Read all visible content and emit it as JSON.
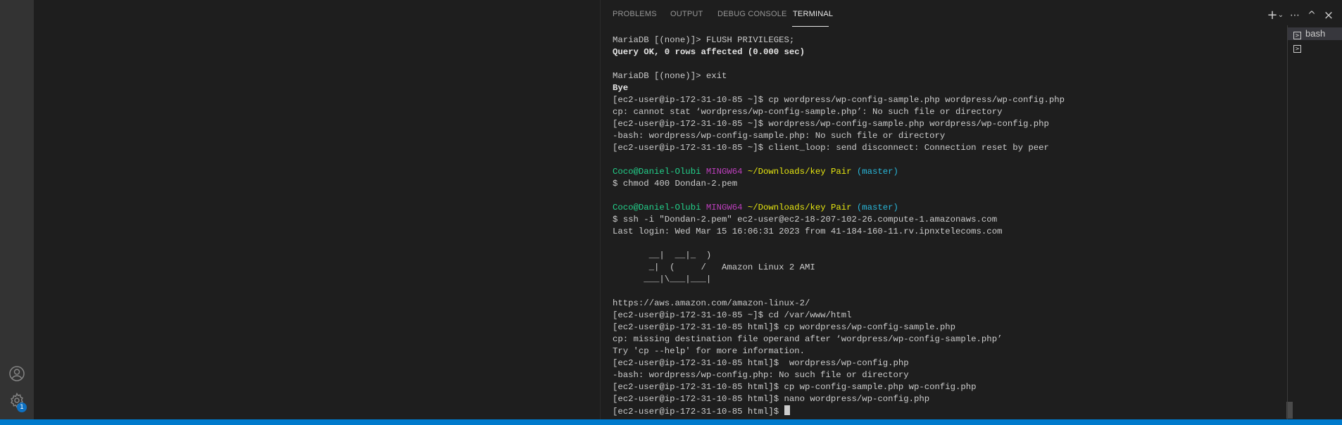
{
  "activity_bar": {
    "accounts_icon": "account-icon",
    "settings_icon": "gear-icon",
    "settings_badge": "1"
  },
  "panel": {
    "tabs": [
      {
        "label": "PROBLEMS"
      },
      {
        "label": "OUTPUT"
      },
      {
        "label": "DEBUG CONSOLE"
      },
      {
        "label": "TERMINAL"
      }
    ],
    "toolbar": {
      "new_terminal": "+",
      "dropdown": "⌄",
      "more": "⋯",
      "maximize": "^",
      "close": "×"
    },
    "terminal_list": [
      {
        "label": "bash"
      },
      {
        "label": ""
      }
    ]
  },
  "terminal": {
    "lines": [
      {
        "text": "MariaDB [(none)]> FLUSH PRIVILEGES;"
      },
      {
        "text": "Query OK, 0 rows affected (0.000 sec)"
      },
      {
        "text": ""
      },
      {
        "text": "MariaDB [(none)]> exit"
      },
      {
        "text": "Bye"
      },
      {
        "text": "[ec2-user@ip-172-31-10-85 ~]$ cp wordpress/wp-config-sample.php wordpress/wp-config.php"
      },
      {
        "text": "cp: cannot stat ‘wordpress/wp-config-sample.php’: No such file or directory"
      },
      {
        "text": "[ec2-user@ip-172-31-10-85 ~]$ wordpress/wp-config-sample.php wordpress/wp-config.php"
      },
      {
        "text": "-bash: wordpress/wp-config-sample.php: No such file or directory"
      },
      {
        "text": "[ec2-user@ip-172-31-10-85 ~]$ client_loop: send disconnect: Connection reset by peer"
      },
      {
        "text": ""
      },
      {
        "user": "Coco@Daniel-Olubi",
        "host": "MINGW64",
        "path": "~/Downloads/key Pair",
        "branch": "(master)"
      },
      {
        "text": "$ chmod 400 Dondan-2.pem"
      },
      {
        "text": ""
      },
      {
        "user": "Coco@Daniel-Olubi",
        "host": "MINGW64",
        "path": "~/Downloads/key Pair",
        "branch": "(master)"
      },
      {
        "text": "$ ssh -i \"Dondan-2.pem\" ec2-user@ec2-18-207-102-26.compute-1.amazonaws.com"
      },
      {
        "text": "Last login: Wed Mar 15 16:06:31 2023 from 41-184-160-11.rv.ipnxtelecoms.com"
      },
      {
        "text": ""
      },
      {
        "text": "       __|  __|_  )"
      },
      {
        "text": "       _|  (     /   Amazon Linux 2 AMI"
      },
      {
        "text": "      ___|\\___|___|"
      },
      {
        "text": ""
      },
      {
        "text": "https://aws.amazon.com/amazon-linux-2/"
      },
      {
        "text": "[ec2-user@ip-172-31-10-85 ~]$ cd /var/www/html"
      },
      {
        "text": "[ec2-user@ip-172-31-10-85 html]$ cp wordpress/wp-config-sample.php"
      },
      {
        "text": "cp: missing destination file operand after ‘wordpress/wp-config-sample.php’"
      },
      {
        "text": "Try 'cp --help' for more information."
      },
      {
        "text": "[ec2-user@ip-172-31-10-85 html]$  wordpress/wp-config.php"
      },
      {
        "text": "-bash: wordpress/wp-config.php: No such file or directory"
      },
      {
        "text": "[ec2-user@ip-172-31-10-85 html]$ cp wp-config-sample.php wp-config.php"
      },
      {
        "text": "[ec2-user@ip-172-31-10-85 html]$ nano wordpress/wp-config.php"
      },
      {
        "text": "[ec2-user@ip-172-31-10-85 html]$ "
      }
    ]
  },
  "colors": {
    "status_bar": "#007acc",
    "prompt_user": "#23d18b",
    "prompt_host": "#bc3fbc",
    "prompt_path": "#e5e510",
    "prompt_branch": "#29b8db"
  }
}
